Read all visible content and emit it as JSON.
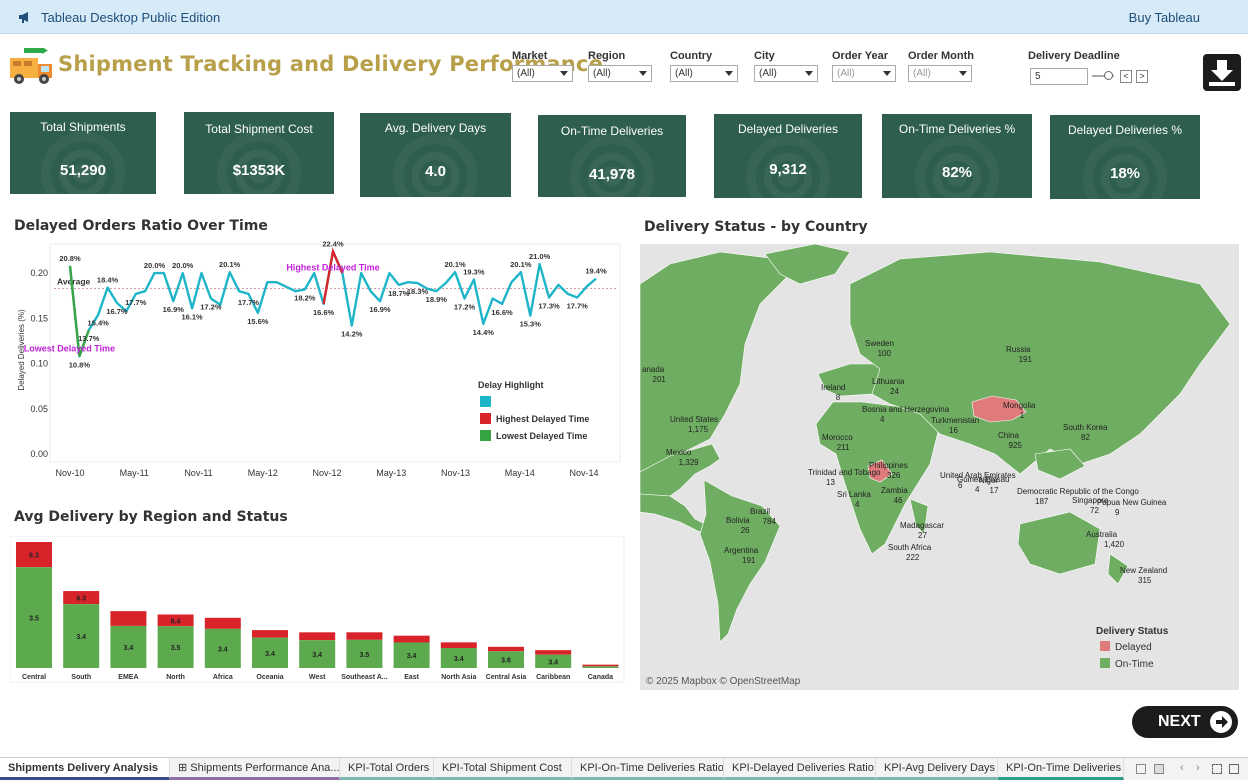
{
  "banner": {
    "app_name": "Tableau Desktop Public Edition",
    "buy": "Buy Tableau"
  },
  "title": "Shipment Tracking and Delivery Performance",
  "filters": [
    {
      "label": "Market",
      "value": "(All)"
    },
    {
      "label": "Region",
      "value": "(All)"
    },
    {
      "label": "Country",
      "value": "(All)"
    },
    {
      "label": "City",
      "value": "(All)"
    },
    {
      "label": "Order Year",
      "value": "(All)"
    },
    {
      "label": "Order Month",
      "value": "(All)"
    }
  ],
  "deadline": {
    "label": "Delivery Deadline",
    "value": "5",
    "prev": "<",
    "next": ">"
  },
  "kpis": [
    {
      "label": "Total Shipments",
      "value": "51,290"
    },
    {
      "label": "Total Shipment Cost",
      "value": "$1353K"
    },
    {
      "label": "Avg. Delivery Days",
      "value": "4.0"
    },
    {
      "label": "On-Time Deliveries",
      "value": "41,978"
    },
    {
      "label": "Delayed Deliveries",
      "value": "9,312"
    },
    {
      "label": "On-Time Deliveries %",
      "value": "82%"
    },
    {
      "label": "Delayed Deliveries %",
      "value": "18%"
    }
  ],
  "colors": {
    "kpi_bg": "#2e5e4e",
    "line": "#1fb5c9",
    "delayed": "#d9232b",
    "on_time": "#39a443",
    "title": "#b8a04a",
    "highlight_text": "#c021d6"
  },
  "line_chart_title": "Delayed Orders Ratio Over Time",
  "bar_chart_title": "Avg Delivery by Region and Status",
  "map_title": "Delivery Status - by Country",
  "map_attribution": "© 2025 Mapbox © OpenStreetMap",
  "map_labels": [
    {
      "name": "Sweden",
      "value": "100"
    },
    {
      "name": "Russia",
      "value": "191"
    },
    {
      "name": "anada",
      "value": "201"
    },
    {
      "name": "Ireland",
      "value": "8"
    },
    {
      "name": "Lithuania",
      "value": "24"
    },
    {
      "name": "Bosnia and Herzegovina",
      "value": "4"
    },
    {
      "name": "Mongolia",
      "value": "1"
    },
    {
      "name": "United States",
      "value": "1,175"
    },
    {
      "name": "Turkmenistan",
      "value": "16"
    },
    {
      "name": "South Korea",
      "value": "82"
    },
    {
      "name": "Morocco",
      "value": "211"
    },
    {
      "name": "China",
      "value": "925"
    },
    {
      "name": "Mexico",
      "value": "1,329"
    },
    {
      "name": "United Arab Emirates",
      "value": "6"
    },
    {
      "name": "Philippines",
      "value": "326"
    },
    {
      "name": "Trinidad and Tobago",
      "value": "13"
    },
    {
      "name": "Niger",
      "value": "17"
    },
    {
      "name": "Guinea-Bissau",
      "value": "4"
    },
    {
      "name": "Sri Lanka",
      "value": "4"
    },
    {
      "name": "Democratic Republic of the Congo",
      "value": "187"
    },
    {
      "name": "Singapore",
      "value": "72"
    },
    {
      "name": "Papua New Guinea",
      "value": "9"
    },
    {
      "name": "Brazil",
      "value": "784"
    },
    {
      "name": "Bolivia",
      "value": "26"
    },
    {
      "name": "Zambia",
      "value": "46"
    },
    {
      "name": "Madagascar",
      "value": "27"
    },
    {
      "name": "Australia",
      "value": "1,420"
    },
    {
      "name": "Argentina",
      "value": "191"
    },
    {
      "name": "South Africa",
      "value": "222"
    },
    {
      "name": "New Zealand",
      "value": "315"
    }
  ],
  "map_legend": {
    "title": "Delivery Status",
    "items": [
      {
        "label": "Delayed",
        "color": "#e07b7b"
      },
      {
        "label": "On-Time",
        "color": "#6fae62"
      }
    ]
  },
  "tabs": [
    "Shipments Delivery Analysis",
    "Shipments Performance Ana...",
    "KPI-Total Orders",
    "KPI-Total Shipment Cost",
    "KPI-On-Time Deliveries Ratio",
    "KPI-Delayed Deliveries Ratio",
    "KPI-Avg Delivery Days",
    "KPI-On-Time Deliveries"
  ],
  "next_label": "NEXT",
  "chart_data": [
    {
      "type": "line",
      "title": "Delayed Orders Ratio Over Time",
      "ylabel": "Delayed Deliveries (%)",
      "ylim": [
        0,
        0.23
      ],
      "yticks": [
        "0.00",
        "0.05",
        "0.10",
        "0.15",
        "0.20"
      ],
      "xticks": [
        "Nov-10",
        "May-11",
        "Nov-11",
        "May-12",
        "Nov-12",
        "May-13",
        "Nov-13",
        "May-14",
        "Nov-14"
      ],
      "average": 0.183,
      "average_label": "Average",
      "highest_label": "Highest Delayed Time",
      "lowest_label": "Lowest Delayed Time",
      "legend": {
        "title": "Delay Highlight",
        "items": [
          "",
          "Highest Delayed Time",
          "Lowest Delayed Time"
        ]
      },
      "values": [
        0.208,
        0.108,
        0.137,
        0.154,
        0.184,
        0.167,
        0.158,
        0.177,
        0.18,
        0.2,
        0.2,
        0.169,
        0.2,
        0.161,
        0.2,
        0.172,
        0.165,
        0.201,
        0.18,
        0.177,
        0.156,
        0.19,
        0.19,
        0.185,
        0.18,
        0.182,
        0.2,
        0.166,
        0.224,
        0.2,
        0.142,
        0.2,
        0.18,
        0.169,
        0.2,
        0.187,
        0.19,
        0.189,
        0.183,
        0.18,
        0.189,
        0.201,
        0.172,
        0.193,
        0.144,
        0.172,
        0.166,
        0.19,
        0.201,
        0.153,
        0.21,
        0.173,
        0.187,
        0.177,
        0.173,
        0.185,
        0.194
      ],
      "point_labels": [
        {
          "i": 0,
          "t": "20.8%"
        },
        {
          "i": 1,
          "t": "10.8%"
        },
        {
          "i": 2,
          "t": "13.7%"
        },
        {
          "i": 3,
          "t": "15.4%"
        },
        {
          "i": 4,
          "t": "18.4%"
        },
        {
          "i": 5,
          "t": "16.7%"
        },
        {
          "i": 7,
          "t": "17.7%"
        },
        {
          "i": 9,
          "t": "20.0%"
        },
        {
          "i": 11,
          "t": "16.9%"
        },
        {
          "i": 12,
          "t": "20.0%"
        },
        {
          "i": 13,
          "t": "16.1%"
        },
        {
          "i": 15,
          "t": "17.2%"
        },
        {
          "i": 17,
          "t": "20.1%"
        },
        {
          "i": 19,
          "t": "17.7%"
        },
        {
          "i": 20,
          "t": "15.6%"
        },
        {
          "i": 25,
          "t": "18.2%"
        },
        {
          "i": 27,
          "t": "16.6%"
        },
        {
          "i": 28,
          "t": "22.4%"
        },
        {
          "i": 30,
          "t": "14.2%"
        },
        {
          "i": 33,
          "t": "16.9%"
        },
        {
          "i": 35,
          "t": "18.7%"
        },
        {
          "i": 37,
          "t": "18.3%"
        },
        {
          "i": 39,
          "t": "18.9%"
        },
        {
          "i": 41,
          "t": "20.1%"
        },
        {
          "i": 42,
          "t": "17.2%"
        },
        {
          "i": 43,
          "t": "19.3%"
        },
        {
          "i": 44,
          "t": "14.4%"
        },
        {
          "i": 46,
          "t": "16.6%"
        },
        {
          "i": 48,
          "t": "20.1%"
        },
        {
          "i": 49,
          "t": "15.3%"
        },
        {
          "i": 50,
          "t": "21.0%"
        },
        {
          "i": 51,
          "t": "17.3%"
        },
        {
          "i": 54,
          "t": "17.7%"
        },
        {
          "i": 56,
          "t": "19.4%"
        }
      ]
    },
    {
      "type": "bar",
      "title": "Avg Delivery by Region and Status",
      "categories": [
        "Central",
        "South",
        "EMEA",
        "North",
        "Africa",
        "Oceania",
        "West",
        "Southeast A...",
        "East",
        "North Asia",
        "Central Asia",
        "Caribbean",
        "Canada"
      ],
      "series": [
        {
          "name": "On-Time",
          "values": [
            3.5,
            3.4,
            3.4,
            3.5,
            3.4,
            3.4,
            3.4,
            3.5,
            3.4,
            3.4,
            3.6,
            3.4,
            null
          ]
        },
        {
          "name": "Delayed",
          "values": [
            6.3,
            6.3,
            null,
            6.4,
            null,
            null,
            null,
            null,
            null,
            null,
            null,
            null,
            null
          ]
        }
      ],
      "totals": [
        11.3,
        6.9,
        5.1,
        4.8,
        4.5,
        3.4,
        3.2,
        3.2,
        2.9,
        2.3,
        1.9,
        1.6,
        0.3
      ],
      "ontime_share": [
        0.8,
        0.83,
        0.74,
        0.78,
        0.78,
        0.8,
        0.78,
        0.79,
        0.79,
        0.78,
        0.79,
        0.75,
        0.5
      ]
    }
  ]
}
